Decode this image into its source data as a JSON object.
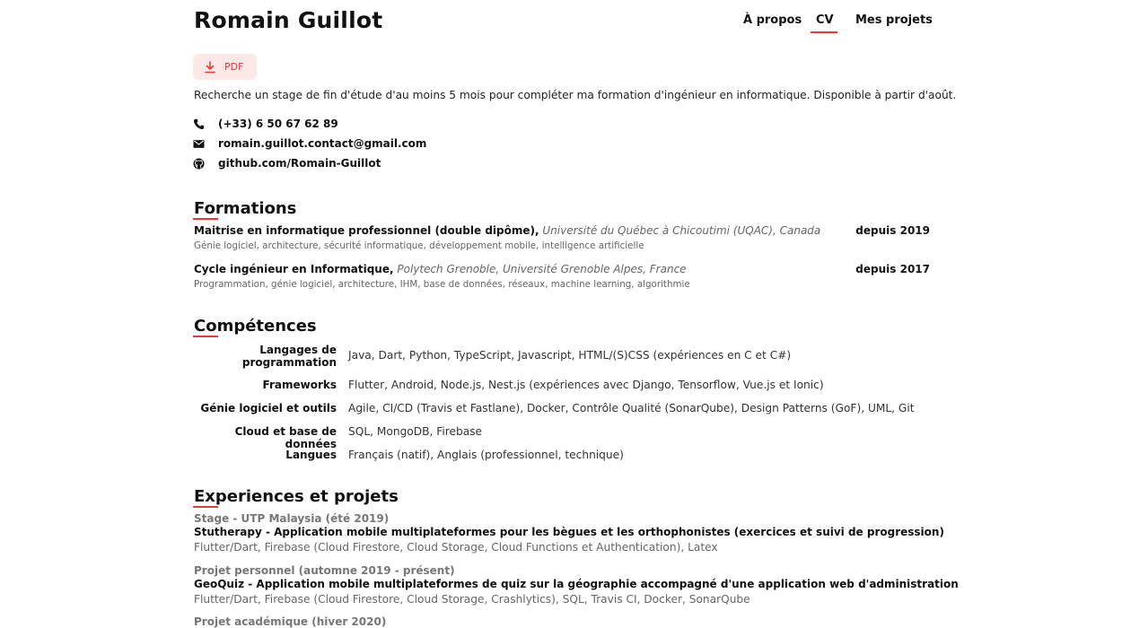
{
  "header": {
    "name": "Romain Guillot",
    "nav": [
      {
        "label": "À propos",
        "active": false
      },
      {
        "label": "CV",
        "active": true
      },
      {
        "label": "Mes projets",
        "active": false
      }
    ]
  },
  "pdf_button": {
    "label": "PDF",
    "icon": "download-icon"
  },
  "intro": "Recherche un stage de fin d'étude d'au moins 5 mois pour compléter ma formation d'ingénieur en informatique. Disponible à partir d'août.",
  "contact": [
    {
      "icon": "phone-icon",
      "text": "(+33) 6 50 67 62 89"
    },
    {
      "icon": "mail-icon",
      "text": "romain.guillot.contact@gmail.com"
    },
    {
      "icon": "github-icon",
      "text": "github.com/Romain-Guillot"
    }
  ],
  "formations": {
    "title": "Formations",
    "items": [
      {
        "degree": "Maitrise en informatique professionnel (double dipôme),",
        "school": "Université du Québec à Chicoutimi (UQAC), Canada",
        "date": "depuis 2019",
        "description": "Génie logiciel, architecture, sécurité informatique, développement mobile, intelligence artificielle"
      },
      {
        "degree": "Cycle ingénieur en Informatique,",
        "school": "Polytech Grenoble, Université Grenoble Alpes, France",
        "date": "depuis 2017",
        "description": "Programmation, génie logiciel, architecture, IHM, base de données, réseaux, machine learning, algorithmie"
      }
    ]
  },
  "competences": {
    "title": "Compétences",
    "items": [
      {
        "label_line1": "Langages de",
        "label_line2": "programmation",
        "value": "Java, Dart, Python, TypeScript, Javascript, HTML/(S)CSS (expériences en C et C#)"
      },
      {
        "label": "Frameworks",
        "value": "Flutter, Android, Node.js, Nest.js (expériences avec Django, Tensorflow, Vue.js et Ionic)"
      },
      {
        "label": "Génie logiciel et outils",
        "value": "Agile, CI/CD (Travis et Fastlane), Docker, Contrôle Qualité (SonarQube), Design Patterns (GoF), UML, Git"
      },
      {
        "label": "Cloud et base de données",
        "value": "SQL, MongoDB, Firebase"
      },
      {
        "label": "Langues",
        "value": "Français (natif), Anglais (professionnel, technique)"
      }
    ]
  },
  "experiences": {
    "title": "Experiences et projets",
    "items": [
      {
        "context": "Stage - UTP Malaysia (été 2019)",
        "title": "Stutherapy - Application mobile multiplateformes pour les bègues et les orthophonistes (exercices et suivi de progression)",
        "tech": "Flutter/Dart, Firebase (Cloud Firestore, Cloud Storage, Cloud Functions et Authentication), Latex"
      },
      {
        "context": "Projet personnel (automne 2019 - présent)",
        "title": "GeoQuiz - Application mobile multiplateformes de quiz sur la géographie accompagné d'une application web d'administration",
        "tech": "Flutter/Dart, Firebase (Cloud Firestore, Cloud Storage, Crashlytics), SQL, Travis CI, Docker, SonarQube"
      },
      {
        "context": "Projet académique (hiver 2020)"
      }
    ]
  },
  "colors": {
    "accent": "#e53935",
    "pdf_bg": "#fde8e8",
    "muted": "#666666"
  }
}
